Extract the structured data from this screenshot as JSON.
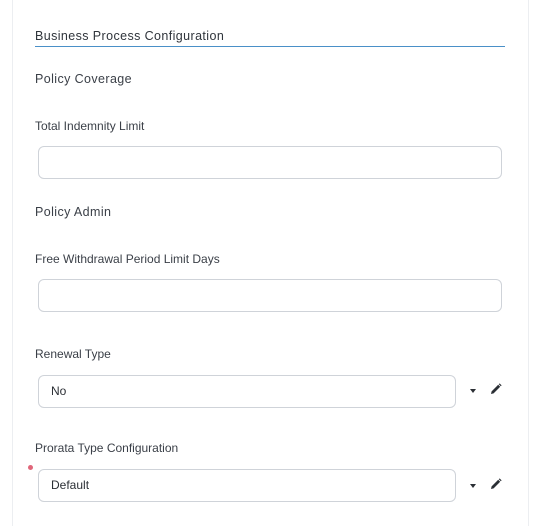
{
  "section": {
    "title": "Business Process Configuration"
  },
  "groups": {
    "policy_coverage": "Policy Coverage",
    "policy_admin": "Policy Admin"
  },
  "fields": {
    "total_indemnity_limit": {
      "label": "Total Indemnity Limit",
      "value": ""
    },
    "free_withdrawal_period": {
      "label": "Free Withdrawal Period Limit Days",
      "value": ""
    },
    "renewal_type": {
      "label": "Renewal Type",
      "value": "No"
    },
    "prorata_type": {
      "label": "Prorata Type Configuration",
      "value": "Default",
      "required": true
    }
  },
  "icons": {
    "dropdown": "caret-down-icon",
    "edit": "pencil-icon"
  },
  "colors": {
    "accent_underline": "#4a90c8",
    "required": "#e0667a",
    "input_border": "#cfd3d9"
  }
}
